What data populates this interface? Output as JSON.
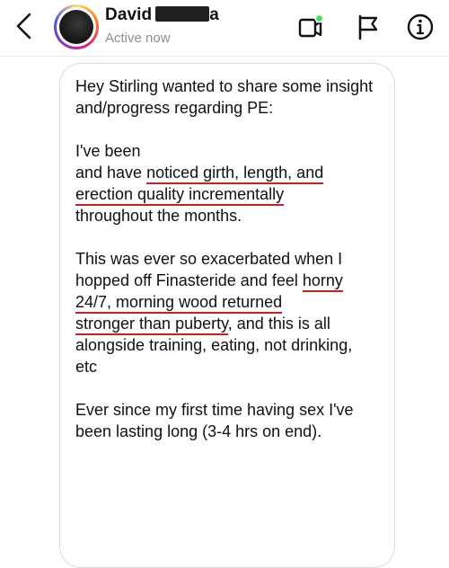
{
  "header": {
    "name": "David",
    "name_tail": "a",
    "status": "Active now",
    "icons": {
      "back": "chevron-left-icon",
      "avatar": "profile-photo",
      "video": "video-call-icon",
      "flag": "flag-icon",
      "info": "info-icon"
    },
    "online_dot_color": "#4cd964"
  },
  "message": {
    "p1": "Hey Stirling wanted to share some insight and/progress regarding PE:",
    "p2_a": "I've been",
    "p2_b": "and have ",
    "p2_hl1": "noticed girth, length, and",
    "p2_hl2": "erection quality incrementally",
    "p2_c": "throughout the months.",
    "p3_a": "This was ever so exacerbated when I hopped off Finasteride and feel ",
    "p3_hl1": "horny 24/7, morning wood returned",
    "p3_hl2": "stronger than puberty",
    "p3_b": ", and this is all alongside training, eating, not drinking, etc",
    "p4": "Ever since my first time having sex I've been lasting long (3-4 hrs on end).",
    "underline_color": "#d41e1e"
  }
}
